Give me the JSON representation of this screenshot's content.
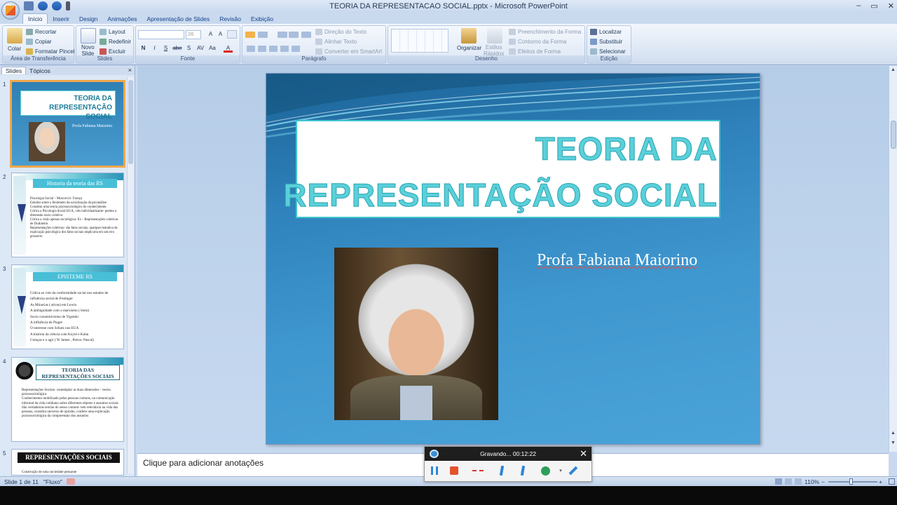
{
  "window": {
    "title": "TEORIA DA REPRESENTACAO SOCIAL.pptx - Microsoft PowerPoint",
    "minimize": "–",
    "restore": "▭",
    "close": "✕"
  },
  "ribbon_tabs": [
    "Início",
    "Inserir",
    "Design",
    "Animações",
    "Apresentação de Slides",
    "Revisão",
    "Exibição"
  ],
  "ribbon": {
    "clipboard": {
      "label": "Área de Transferência",
      "paste": "Colar",
      "cut": "Recortar",
      "copy": "Copiar",
      "format_painter": "Formatar Pincel"
    },
    "slides": {
      "label": "Slides",
      "new_slide_1": "Novo",
      "new_slide_2": "Slide",
      "layout": "Layout",
      "reset": "Redefinir",
      "delete": "Excluir"
    },
    "font": {
      "label": "Fonte",
      "size": "26",
      "bold": "N",
      "italic": "I",
      "underline": "S",
      "strike": "abe",
      "shadow": "S",
      "spacing": "AV",
      "case": "Aa",
      "grow": "A",
      "shrink": "A",
      "color": "A"
    },
    "paragraph": {
      "label": "Parágrafo",
      "text_direction": "Direção do Texto",
      "align_text": "Alinhar Texto",
      "convert_smartart": "Converter em SmartArt"
    },
    "drawing": {
      "label": "Desenho",
      "arrange": "Organizar",
      "quick_styles_1": "Estilos",
      "quick_styles_2": "Rápidos",
      "shape_fill": "Preenchimento da Forma",
      "shape_outline": "Contorno da Forma",
      "shape_effects": "Efeitos de Forma"
    },
    "editing": {
      "label": "Edição",
      "find": "Localizar",
      "replace": "Substituir",
      "select": "Selecionar"
    }
  },
  "left_panel": {
    "tab_slides": "Slides",
    "tab_outline": "Tópicos",
    "close": "×",
    "thumbnails": [
      {
        "num": "1",
        "title_line1": "TEORIA DA",
        "title_line2": "REPRESENTAÇÃO SOCIAL",
        "subtitle": "Profa Fabiana Maiorino"
      },
      {
        "num": "2",
        "title": "Historia da teoria das RS",
        "bullets": [
          "Psicologia Social – Moscovici- França",
          "Estudos sobre o fenômeno da socialização da psicanálise",
          "Constitui uma teoria psicossociológico do conhecimento",
          "Crítica a Psicologia Social EUA, viés individualizante- perdeu a dimensão sócio coletiva",
          "Crítica a visão apenas sociológica- Es – Representações coletivas de Durkheim",
          "Representações coletivas- são fatos sociais, qualquer tentativa de explicação psicológica dos fatos sociais implicaria em um erro grosseiro"
        ]
      },
      {
        "num": "3",
        "title": "EPISTEME RS",
        "bullets": [
          "Crítica ao viés da conformidade social nos estudos de influência social de Festinger",
          "As Minorias ( ativas) em Lewin",
          "A ambiguidade com o marxismo ( lenin)",
          "Socio construtivismo de Vigotski",
          "A influência de Piaget",
          "O interesse com Schutz nos EUA",
          "A história da ciência com Koyré e Kuhn",
          "Crenças e o agir ( W James , Peirce, Pascal)"
        ]
      },
      {
        "num": "4",
        "title_line1": "TEORIA DAS",
        "title_line2": "REPRESENTAÇÕES SOCIAIS",
        "bullets": [
          "Representações Sociais- contemplar as duas dimensões – teoria psicossociológica",
          "Conhecimento mobilizado pelas pessoas comuns, na comunicação informal da vida cotidiana sobre diferentes objetos e assuntos sociais",
          "São verdadeiras teorias do senso comum- tem relevância na vida das pessoas, constitui universo de opinião, confere uma explicação psicossociológica da compreensão dos assuntos"
        ]
      },
      {
        "num": "5",
        "title": "REPRESENTAÇÕES SOCIAIS",
        "bullets": [
          "Construção de uma sociedade pensante"
        ]
      }
    ]
  },
  "slide": {
    "title_line1": "TEORIA DA",
    "title_line2": "REPRESENTAÇÃO SOCIAL",
    "subtitle": "Profa Fabiana Maiorino"
  },
  "notes": {
    "placeholder": "Clique para adicionar anotações"
  },
  "status_bar": {
    "slide_info": "Slide 1 de 11",
    "theme": "\"Fluxo\"",
    "zoom": "110%"
  },
  "recorder": {
    "status": "Gravando... 00:12:22",
    "close": "✕"
  },
  "colors": {
    "title_text": "#5ad0d9",
    "title_border": "#3fc5cf",
    "slide_bg": "#2f82bb",
    "selected_thumb": "#f3a64a",
    "stop_red": "#e6522c"
  }
}
